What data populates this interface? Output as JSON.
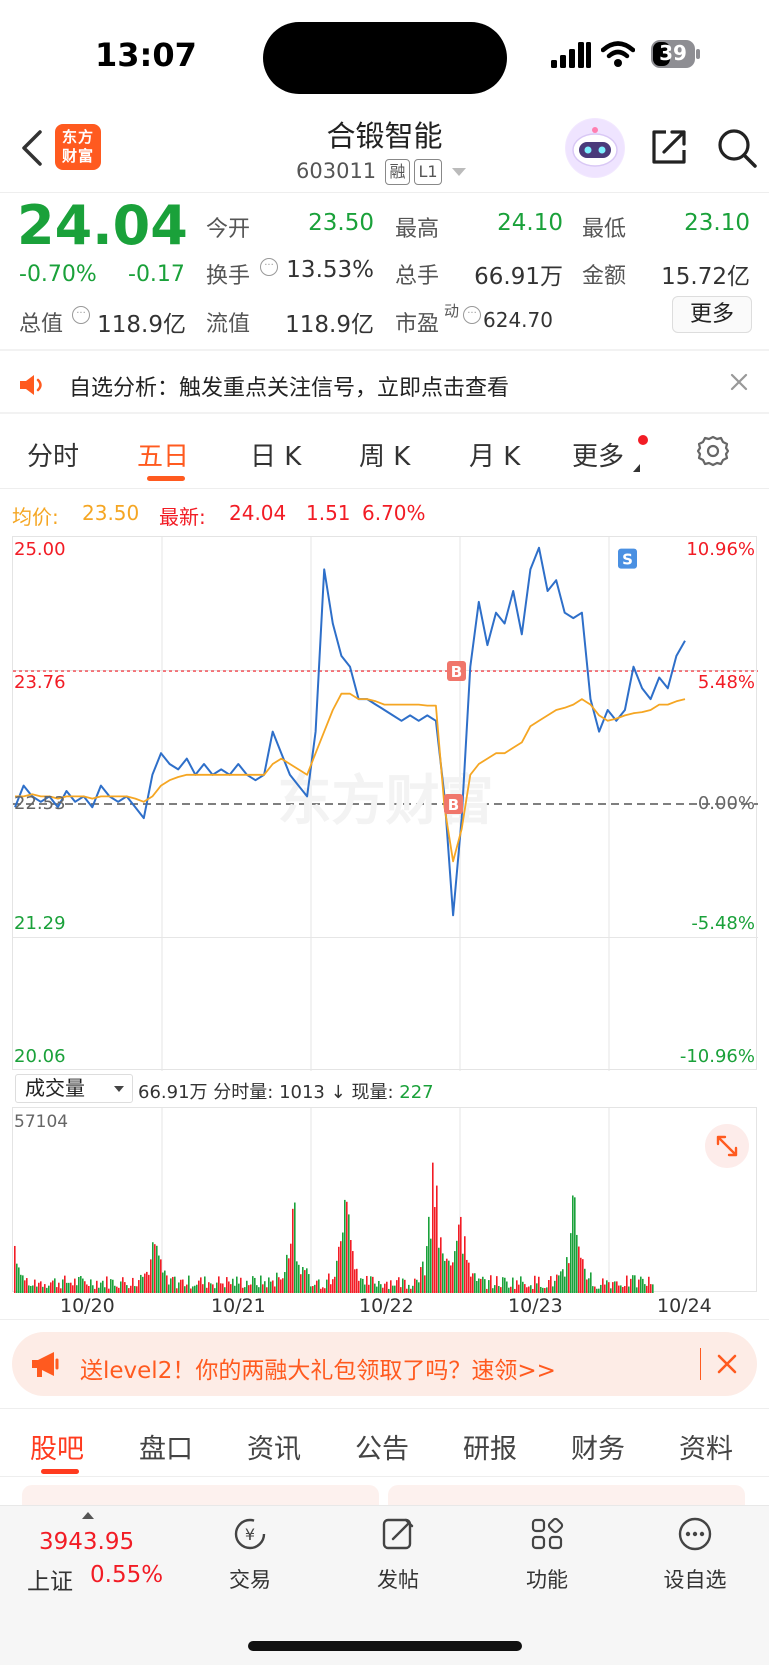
{
  "status": {
    "time": "13:07",
    "battery": "39"
  },
  "header": {
    "logo_text_1": "东方",
    "logo_text_2": "财富",
    "stock_name": "合锻智能",
    "stock_code": "603011",
    "tag_rong": "融",
    "tag_level": "L1"
  },
  "quote": {
    "price": "24.04",
    "change_pct": "-0.70%",
    "change_amt": "-0.17",
    "open_label": "今开",
    "open_value": "23.50",
    "high_label": "最高",
    "high_value": "24.10",
    "low_label": "最低",
    "low_value": "23.10",
    "turnover_label": "换手",
    "turnover_value": "13.53%",
    "volume_label": "总手",
    "volume_value": "66.91万",
    "amount_label": "金额",
    "amount_value": "15.72亿",
    "mktcap_label": "总值",
    "mktcap_value": "118.9亿",
    "float_label": "流值",
    "float_value": "118.9亿",
    "pe_label": "市盈",
    "pe_sup": "动",
    "pe_value": "624.70",
    "more_button": "更多"
  },
  "notice": {
    "text": "自选分析：触发重点关注信号，立即点击查看"
  },
  "chart_tabs": [
    "分时",
    "五日",
    "日 K",
    "周 K",
    "月 K",
    "更多"
  ],
  "chart_tab_active": "五日",
  "summary": {
    "avg_label": "均价:",
    "avg_value": "23.50",
    "latest_label": "最新:",
    "latest_value": "24.04",
    "latest_change": "1.51",
    "latest_pct": "6.70%"
  },
  "chart_data": {
    "type": "line",
    "y_left_ticks": [
      "25.00",
      "23.76",
      "22.53",
      "21.29",
      "20.06"
    ],
    "y_right_ticks": [
      "10.96%",
      "5.48%",
      "0.00%",
      "-5.48%",
      "-10.96%"
    ],
    "ylim": [
      20.06,
      25.0
    ],
    "x_ticks": [
      "10/20",
      "10/21",
      "10/22",
      "10/23",
      "10/24"
    ],
    "series": [
      {
        "name": "",
        "values": [
          22.5,
          22.7,
          22.6,
          22.55,
          22.6,
          22.5,
          22.65,
          22.55,
          22.6,
          22.5,
          22.7,
          22.6,
          22.55,
          22.6,
          22.5,
          22.4,
          22.8,
          23.0,
          22.9,
          22.85,
          22.95,
          22.8,
          22.9,
          22.8,
          22.85,
          22.8,
          22.9,
          22.8,
          22.75,
          22.8,
          23.2,
          23.0,
          22.8,
          22.7,
          22.6,
          23.2,
          24.7,
          24.2,
          23.9,
          23.8,
          23.5,
          23.5,
          23.45,
          23.4,
          23.35,
          23.3,
          23.35,
          23.3,
          23.35,
          23.3,
          22.6,
          21.5,
          22.4,
          23.8,
          24.4,
          24.0,
          24.3,
          24.2,
          24.5,
          24.1,
          24.7,
          24.9,
          24.5,
          24.6,
          24.3,
          24.25,
          24.3,
          23.5,
          23.2,
          23.4,
          23.3,
          23.4,
          23.8,
          23.6,
          23.5,
          23.7,
          23.6,
          23.9,
          24.04
        ]
      },
      {
        "name": "",
        "values": [
          22.6,
          22.6,
          22.62,
          22.6,
          22.6,
          22.58,
          22.6,
          22.6,
          22.6,
          22.58,
          22.6,
          22.6,
          22.6,
          22.6,
          22.58,
          22.55,
          22.6,
          22.7,
          22.75,
          22.78,
          22.8,
          22.8,
          22.8,
          22.8,
          22.8,
          22.8,
          22.8,
          22.8,
          22.8,
          22.8,
          22.9,
          22.95,
          22.9,
          22.85,
          22.8,
          23.0,
          23.2,
          23.4,
          23.55,
          23.55,
          23.5,
          23.5,
          23.48,
          23.45,
          23.45,
          23.45,
          23.45,
          23.45,
          23.44,
          23.44,
          22.5,
          22.0,
          22.3,
          22.8,
          22.9,
          22.95,
          23.0,
          23.0,
          23.05,
          23.1,
          23.25,
          23.3,
          23.35,
          23.4,
          23.42,
          23.45,
          23.5,
          23.45,
          23.35,
          23.3,
          23.32,
          23.35,
          23.37,
          23.38,
          23.4,
          23.45,
          23.45,
          23.48,
          23.5
        ]
      }
    ],
    "reference_line": 22.53,
    "price_line": 23.76,
    "markers": [
      "B",
      "B",
      "S"
    ],
    "watermark": "东方财富"
  },
  "volume": {
    "selector_label": "成交量",
    "total": "66.91万",
    "bar_label": "分时量:",
    "bar_value": "1013",
    "now_label": "现量:",
    "now_value": "227",
    "max_tick": "57104"
  },
  "banner": {
    "text": "送level2！你的两融大礼包领取了吗？速领>>"
  },
  "bottom_tabs": [
    "股吧",
    "盘口",
    "资讯",
    "公告",
    "研报",
    "财务",
    "资料"
  ],
  "bottom_tab_active": "股吧",
  "footer": {
    "index_value": "3943.95",
    "index_name": "上证",
    "index_pct": "0.55%",
    "nav": [
      "交易",
      "发帖",
      "功能",
      "设自选"
    ]
  }
}
